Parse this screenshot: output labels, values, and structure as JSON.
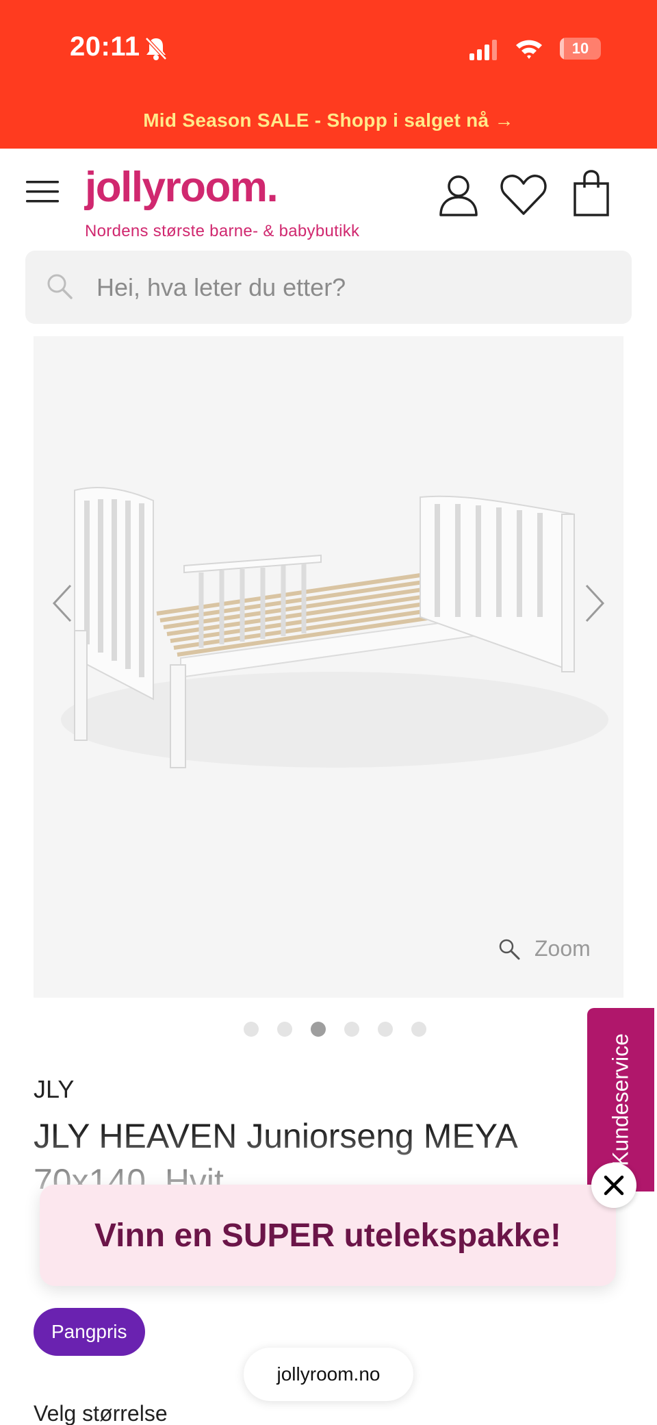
{
  "status_bar": {
    "time": "20:11",
    "battery": "10",
    "battery_level": 0.1
  },
  "promo": {
    "text": "Mid Season SALE - Shopp i salget nå →"
  },
  "header": {
    "logo": "jollyroom.",
    "tagline": "Nordens største barne- & babybutikk",
    "icons": [
      "menu-icon",
      "user-icon",
      "heart-icon",
      "bag-icon"
    ]
  },
  "search": {
    "placeholder": "Hei, hva leter du etter?"
  },
  "gallery": {
    "zoom_label": "Zoom",
    "dots_total": 6,
    "active_dot": 3
  },
  "product": {
    "brand": "JLY",
    "title": "JLY HEAVEN Juniorseng MEYA 70x140, Hvit"
  },
  "side_tab": {
    "label": "Kundeservice"
  },
  "popup": {
    "text": "Vinn en SUPER utelekspakke!"
  },
  "badge": {
    "label": "Pangpris"
  },
  "browser": {
    "url": "jollyroom.no"
  },
  "size": {
    "label": "Velg størrelse"
  },
  "colors": {
    "top_band": "#ff3b1f",
    "promo_text": "#ffe98a",
    "brand_pink": "#d0286f",
    "side_tab": "#b0176b",
    "badge": "#6a22b0",
    "popup_bg": "#fce7ee",
    "popup_text": "#6b1548"
  }
}
